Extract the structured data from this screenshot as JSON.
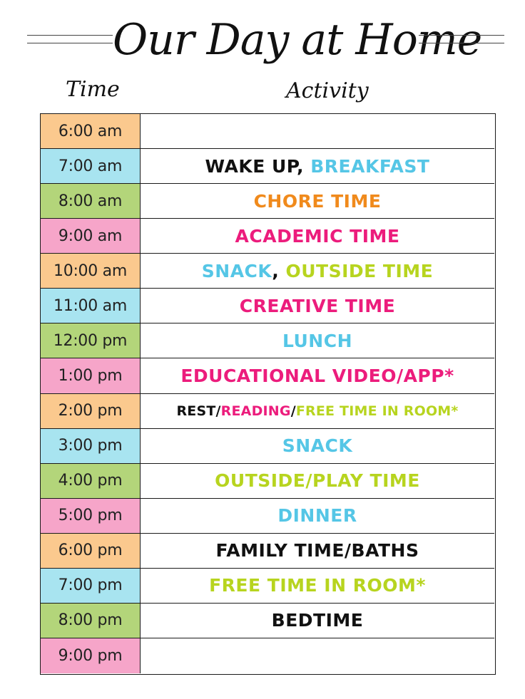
{
  "header": {
    "title": "Our Day at Home",
    "time_label": "Time",
    "activity_label": "Activity"
  },
  "colors": {
    "orange": "#fbc98e",
    "blue": "#a8e4f0",
    "green": "#b3d57a",
    "pink": "#f6a5c9",
    "text_black": "#111111",
    "text_blue": "#55c6e6",
    "text_orange": "#f08a1c",
    "text_pink": "#ec1c7c",
    "text_lime": "#b7d41f"
  },
  "schedule": [
    {
      "time": "6:00 am",
      "fill": "#fbc98e",
      "parts": []
    },
    {
      "time": "7:00 am",
      "fill": "#a8e4f0",
      "parts": [
        {
          "text": "WAKE UP, ",
          "color": "#111111"
        },
        {
          "text": "BREAKFAST",
          "color": "#55c6e6"
        }
      ]
    },
    {
      "time": "8:00 am",
      "fill": "#b3d57a",
      "parts": [
        {
          "text": "CHORE TIME",
          "color": "#f08a1c"
        }
      ]
    },
    {
      "time": "9:00 am",
      "fill": "#f6a5c9",
      "parts": [
        {
          "text": "ACADEMIC TIME",
          "color": "#ec1c7c"
        }
      ]
    },
    {
      "time": "10:00 am",
      "fill": "#fbc98e",
      "parts": [
        {
          "text": "SNACK",
          "color": "#55c6e6"
        },
        {
          "text": ", ",
          "color": "#111111"
        },
        {
          "text": "OUTSIDE TIME",
          "color": "#b7d41f"
        }
      ]
    },
    {
      "time": "11:00 am",
      "fill": "#a8e4f0",
      "parts": [
        {
          "text": "CREATIVE TIME",
          "color": "#ec1c7c"
        }
      ]
    },
    {
      "time": "12:00 pm",
      "fill": "#b3d57a",
      "parts": [
        {
          "text": "LUNCH",
          "color": "#55c6e6"
        }
      ]
    },
    {
      "time": "1:00 pm",
      "fill": "#f6a5c9",
      "parts": [
        {
          "text": "EDUCATIONAL VIDEO/APP*",
          "color": "#ec1c7c"
        }
      ]
    },
    {
      "time": "2:00 pm",
      "fill": "#fbc98e",
      "small": true,
      "parts": [
        {
          "text": "REST/",
          "color": "#111111"
        },
        {
          "text": "READING",
          "color": "#ec1c7c"
        },
        {
          "text": "/",
          "color": "#111111"
        },
        {
          "text": "FREE TIME IN ROOM*",
          "color": "#b7d41f"
        }
      ]
    },
    {
      "time": "3:00 pm",
      "fill": "#a8e4f0",
      "parts": [
        {
          "text": "SNACK",
          "color": "#55c6e6"
        }
      ]
    },
    {
      "time": "4:00 pm",
      "fill": "#b3d57a",
      "parts": [
        {
          "text": "OUTSIDE/PLAY TIME",
          "color": "#b7d41f"
        }
      ]
    },
    {
      "time": "5:00 pm",
      "fill": "#f6a5c9",
      "parts": [
        {
          "text": "DINNER",
          "color": "#55c6e6"
        }
      ]
    },
    {
      "time": "6:00 pm",
      "fill": "#fbc98e",
      "parts": [
        {
          "text": "FAMILY TIME/BATHS",
          "color": "#111111"
        }
      ]
    },
    {
      "time": "7:00 pm",
      "fill": "#a8e4f0",
      "parts": [
        {
          "text": "FREE TIME IN ROOM*",
          "color": "#b7d41f"
        }
      ]
    },
    {
      "time": "8:00 pm",
      "fill": "#b3d57a",
      "parts": [
        {
          "text": "BEDTIME",
          "color": "#111111"
        }
      ]
    },
    {
      "time": "9:00 pm",
      "fill": "#f6a5c9",
      "parts": []
    }
  ]
}
